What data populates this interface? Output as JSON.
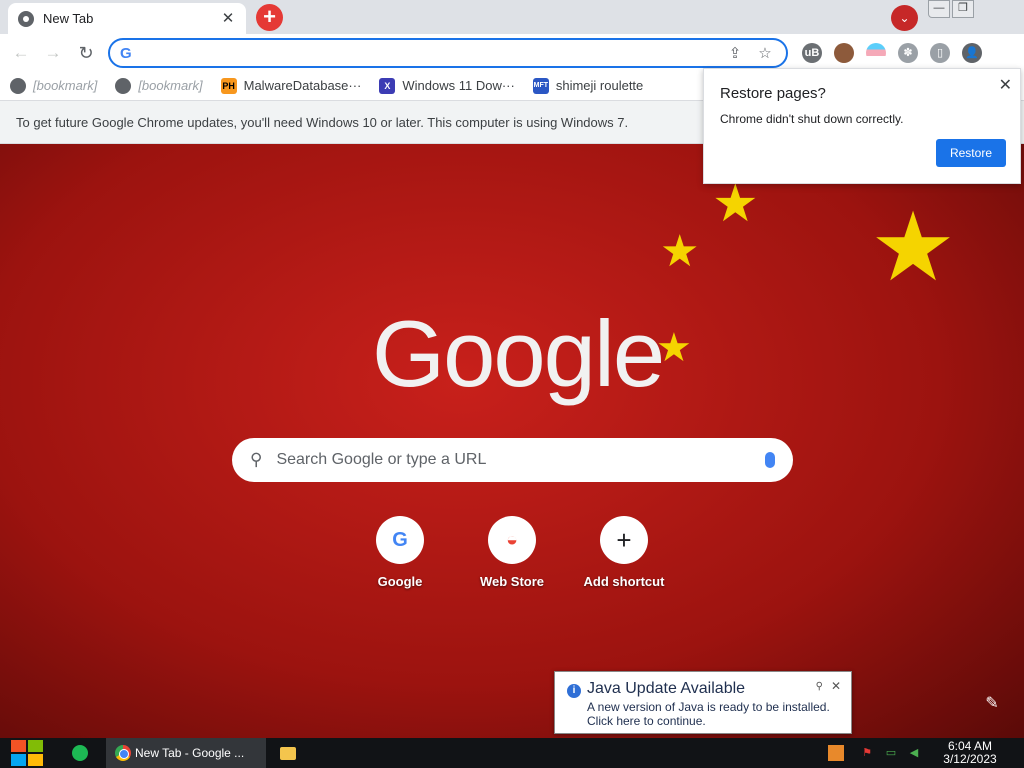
{
  "tabstrip": {
    "tab_title": "New Tab",
    "tab_close": "✕",
    "new_tab": "+",
    "tab_search": "⌄",
    "minimize": "—",
    "maximize": "❐"
  },
  "toolbar": {
    "back": "←",
    "forward": "→",
    "reload": "↻",
    "omnibox_logo": "G",
    "omnibox_value": "",
    "share": "⇪",
    "bookmark_star": "☆"
  },
  "extensions": [
    "uB",
    "",
    "",
    "✽",
    "▯",
    "👤"
  ],
  "bookmarks": [
    {
      "label": "[bookmark]",
      "icon": "gear-icon",
      "redacted": true
    },
    {
      "label": "[bookmark]",
      "icon": "globe-icon",
      "redacted": true
    },
    {
      "label": "MalwareDatabase···",
      "icon": "ph-icon",
      "redacted": false
    },
    {
      "label": "Windows 11 Dow···",
      "icon": "x-icon",
      "redacted": false
    },
    {
      "label": "shimeji roulette",
      "icon": "mft-icon",
      "redacted": false
    }
  ],
  "infobar": {
    "message": "To get future Google Chrome updates, you'll need Windows 10 or later. This computer is using Windows 7."
  },
  "ntp": {
    "logo": "Google",
    "search_placeholder": "Search Google or type a URL",
    "shortcuts": [
      {
        "label": "Google",
        "glyph": "G"
      },
      {
        "label": "Web Store",
        "glyph": "◒"
      },
      {
        "label": "Add shortcut",
        "glyph": "+"
      }
    ],
    "customize": "✎"
  },
  "restore_dialog": {
    "title": "Restore pages?",
    "body": "Chrome didn't shut down correctly.",
    "button": "Restore",
    "close": "✕"
  },
  "java_notification": {
    "title": "Java Update Available",
    "line1": "A new version of Java is ready to be installed.",
    "line2": "Click here to continue.",
    "info": "i",
    "pin": "⚲",
    "close": "✕"
  },
  "taskbar": {
    "chrome_label": "New Tab - Google ...",
    "time": "6:04 AM",
    "date": "3/12/2023"
  },
  "colors": {
    "omnibox_border": "#1a73e8",
    "ntp_background": "#b71c1c",
    "restore_button": "#1a73e8",
    "taskbar": "#111316"
  }
}
